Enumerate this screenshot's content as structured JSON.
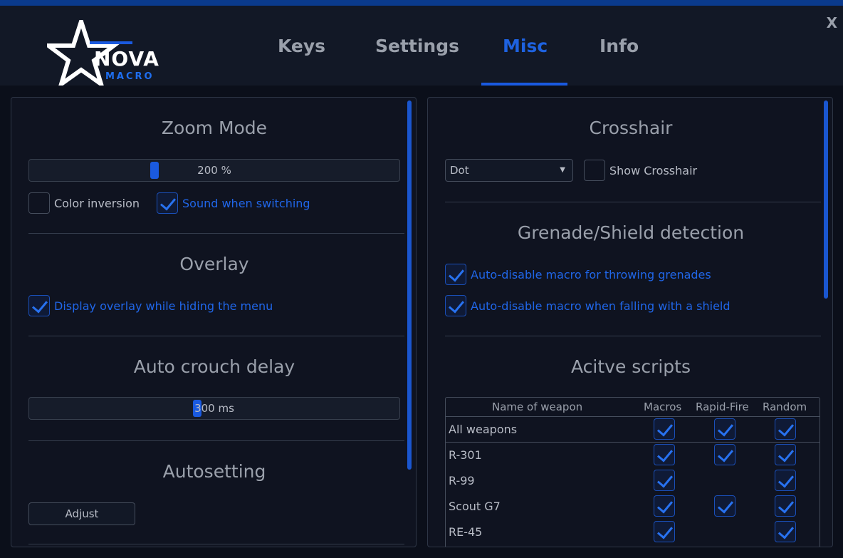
{
  "app": {
    "close_label": "X",
    "logo_word": "NOVA",
    "logo_sub": "MACRO"
  },
  "tabs": [
    {
      "label": "Keys"
    },
    {
      "label": "Settings"
    },
    {
      "label": "Misc",
      "active": true
    },
    {
      "label": "Info"
    }
  ],
  "left": {
    "zoom": {
      "title": "Zoom Mode",
      "slider_value": "200 %",
      "color_inversion": {
        "label": "Color inversion",
        "checked": false
      },
      "sound_switching": {
        "label": "Sound when switching",
        "checked": true
      }
    },
    "overlay": {
      "title": "Overlay",
      "display_overlay": {
        "label": "Display overlay while hiding the menu",
        "checked": true
      }
    },
    "crouch": {
      "title": "Auto crouch delay",
      "slider_value": "300 ms"
    },
    "autosetting": {
      "title": "Autosetting",
      "adjust_label": "Adjust"
    }
  },
  "right": {
    "crosshair": {
      "title": "Crosshair",
      "select_value": "Dot",
      "show": {
        "label": "Show Crosshair",
        "checked": false
      }
    },
    "grenade": {
      "title": "Grenade/Shield detection",
      "grenades": {
        "label": "Auto-disable macro for throwing grenades",
        "checked": true
      },
      "shield": {
        "label": "Auto-disable macro when falling with a shield",
        "checked": true
      }
    },
    "scripts": {
      "title": "Acitve scripts",
      "columns": [
        "Name of weapon",
        "Macros",
        "Rapid-Fire",
        "Random"
      ],
      "rows": [
        {
          "name": "All weapons",
          "macros": true,
          "rapid": true,
          "random": true
        },
        {
          "name": "R-301",
          "macros": true,
          "rapid": true,
          "random": true
        },
        {
          "name": "R-99",
          "macros": true,
          "rapid": false,
          "random": true
        },
        {
          "name": "Scout G7",
          "macros": true,
          "rapid": true,
          "random": true
        },
        {
          "name": "RE-45",
          "macros": true,
          "rapid": false,
          "random": true
        }
      ]
    }
  },
  "colors": {
    "accent": "#1a5ae0",
    "background": "#0b0f1a",
    "text": "#b8bcc6"
  }
}
